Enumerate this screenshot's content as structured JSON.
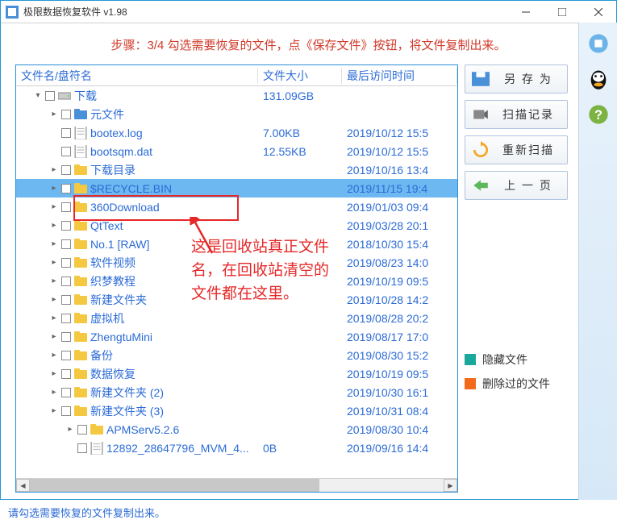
{
  "window": {
    "title": "极限数据恢复软件 v1.98"
  },
  "instruction": "步骤：3/4 勾选需要恢复的文件，点《保存文件》按钮，将文件复制出来。",
  "columns": {
    "name": "文件名/盘符名",
    "size": "文件大小",
    "date": "最后访问时间"
  },
  "rows": [
    {
      "indent": 0,
      "tw": "▾",
      "icon": "drive",
      "name": "下载",
      "size": "131.09GB",
      "date": "",
      "sel": false
    },
    {
      "indent": 1,
      "tw": "▸",
      "icon": "foldb",
      "name": "元文件",
      "size": "",
      "date": "",
      "sel": false
    },
    {
      "indent": 1,
      "tw": "",
      "icon": "file",
      "name": "bootex.log",
      "size": "7.00KB",
      "date": "2019/10/12 15:5",
      "sel": false
    },
    {
      "indent": 1,
      "tw": "",
      "icon": "file",
      "name": "bootsqm.dat",
      "size": "12.55KB",
      "date": "2019/10/12 15:5",
      "sel": false
    },
    {
      "indent": 1,
      "tw": "▸",
      "icon": "fold",
      "name": "下载目录",
      "size": "",
      "date": "2019/10/16 13:4",
      "sel": false
    },
    {
      "indent": 1,
      "tw": "▸",
      "icon": "fold",
      "name": "$RECYCLE.BIN",
      "size": "",
      "date": "2019/11/15 19:4",
      "sel": true
    },
    {
      "indent": 1,
      "tw": "▸",
      "icon": "fold",
      "name": "360Download",
      "size": "",
      "date": "2019/01/03 09:4",
      "sel": false
    },
    {
      "indent": 1,
      "tw": "▸",
      "icon": "fold",
      "name": "QtText",
      "size": "",
      "date": "2019/03/28 20:1",
      "sel": false
    },
    {
      "indent": 1,
      "tw": "▸",
      "icon": "fold",
      "name": "No.1 [RAW]",
      "size": "",
      "date": "2018/10/30 15:4",
      "sel": false
    },
    {
      "indent": 1,
      "tw": "▸",
      "icon": "fold",
      "name": "软件视频",
      "size": "",
      "date": "2019/08/23 14:0",
      "sel": false
    },
    {
      "indent": 1,
      "tw": "▸",
      "icon": "fold",
      "name": "织梦教程",
      "size": "",
      "date": "2019/10/19 09:5",
      "sel": false
    },
    {
      "indent": 1,
      "tw": "▸",
      "icon": "fold",
      "name": "新建文件夹",
      "size": "",
      "date": "2019/10/28 14:2",
      "sel": false
    },
    {
      "indent": 1,
      "tw": "▸",
      "icon": "fold",
      "name": "虚拟机",
      "size": "",
      "date": "2019/08/28 20:2",
      "sel": false
    },
    {
      "indent": 1,
      "tw": "▸",
      "icon": "fold",
      "name": "ZhengtuMini",
      "size": "",
      "date": "2019/08/17 17:0",
      "sel": false
    },
    {
      "indent": 1,
      "tw": "▸",
      "icon": "fold",
      "name": "备份",
      "size": "",
      "date": "2019/08/30 15:2",
      "sel": false
    },
    {
      "indent": 1,
      "tw": "▸",
      "icon": "fold",
      "name": "数据恢复",
      "size": "",
      "date": "2019/10/19 09:5",
      "sel": false
    },
    {
      "indent": 1,
      "tw": "▸",
      "icon": "fold",
      "name": "新建文件夹 (2)",
      "size": "",
      "date": "2019/10/30 16:1",
      "sel": false
    },
    {
      "indent": 1,
      "tw": "▸",
      "icon": "fold",
      "name": "新建文件夹 (3)",
      "size": "",
      "date": "2019/10/31 08:4",
      "sel": false
    },
    {
      "indent": 2,
      "tw": "▸",
      "icon": "fold",
      "name": "APMServ5.2.6",
      "size": "",
      "date": "2019/08/30 10:4",
      "sel": false
    },
    {
      "indent": 2,
      "tw": "",
      "icon": "file",
      "name": "12892_28647796_MVM_4...",
      "size": "0B",
      "date": "2019/09/16 14:4",
      "sel": false
    }
  ],
  "buttons": {
    "save": "另 存 为",
    "scanlog": "扫描记录",
    "rescan": "重新扫描",
    "prev": "上 一 页"
  },
  "legend": {
    "hidden": "隐藏文件",
    "deleted": "删除过的文件"
  },
  "annotation": "这是回收站真正文件名，在回收站清空的文件都在这里。",
  "status": "请勾选需要恢复的文件复制出来。"
}
